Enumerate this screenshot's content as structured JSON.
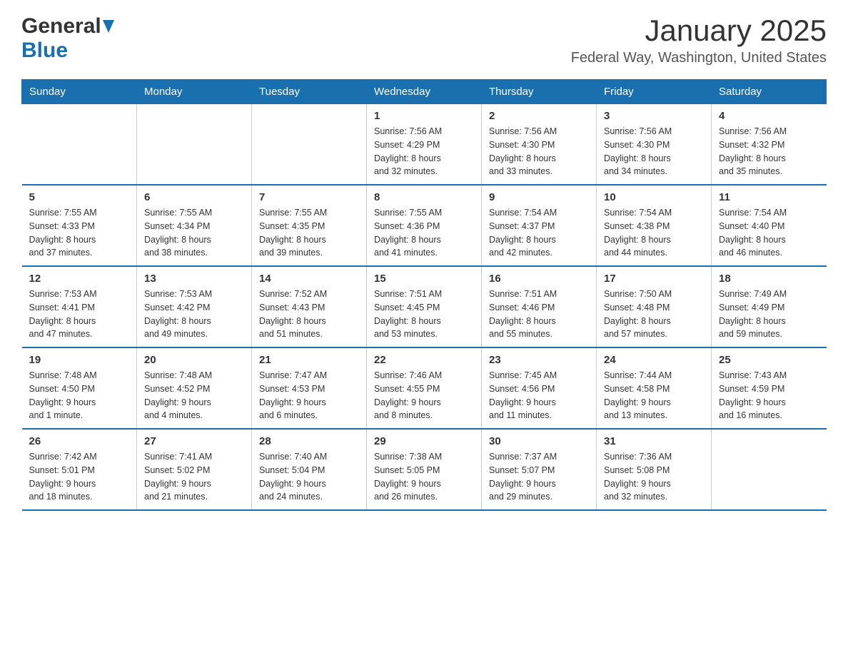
{
  "header": {
    "logo_general": "General",
    "logo_blue": "Blue",
    "month_title": "January 2025",
    "location": "Federal Way, Washington, United States"
  },
  "calendar": {
    "days_of_week": [
      "Sunday",
      "Monday",
      "Tuesday",
      "Wednesday",
      "Thursday",
      "Friday",
      "Saturday"
    ],
    "weeks": [
      [
        {
          "day": "",
          "info": ""
        },
        {
          "day": "",
          "info": ""
        },
        {
          "day": "",
          "info": ""
        },
        {
          "day": "1",
          "info": "Sunrise: 7:56 AM\nSunset: 4:29 PM\nDaylight: 8 hours\nand 32 minutes."
        },
        {
          "day": "2",
          "info": "Sunrise: 7:56 AM\nSunset: 4:30 PM\nDaylight: 8 hours\nand 33 minutes."
        },
        {
          "day": "3",
          "info": "Sunrise: 7:56 AM\nSunset: 4:30 PM\nDaylight: 8 hours\nand 34 minutes."
        },
        {
          "day": "4",
          "info": "Sunrise: 7:56 AM\nSunset: 4:32 PM\nDaylight: 8 hours\nand 35 minutes."
        }
      ],
      [
        {
          "day": "5",
          "info": "Sunrise: 7:55 AM\nSunset: 4:33 PM\nDaylight: 8 hours\nand 37 minutes."
        },
        {
          "day": "6",
          "info": "Sunrise: 7:55 AM\nSunset: 4:34 PM\nDaylight: 8 hours\nand 38 minutes."
        },
        {
          "day": "7",
          "info": "Sunrise: 7:55 AM\nSunset: 4:35 PM\nDaylight: 8 hours\nand 39 minutes."
        },
        {
          "day": "8",
          "info": "Sunrise: 7:55 AM\nSunset: 4:36 PM\nDaylight: 8 hours\nand 41 minutes."
        },
        {
          "day": "9",
          "info": "Sunrise: 7:54 AM\nSunset: 4:37 PM\nDaylight: 8 hours\nand 42 minutes."
        },
        {
          "day": "10",
          "info": "Sunrise: 7:54 AM\nSunset: 4:38 PM\nDaylight: 8 hours\nand 44 minutes."
        },
        {
          "day": "11",
          "info": "Sunrise: 7:54 AM\nSunset: 4:40 PM\nDaylight: 8 hours\nand 46 minutes."
        }
      ],
      [
        {
          "day": "12",
          "info": "Sunrise: 7:53 AM\nSunset: 4:41 PM\nDaylight: 8 hours\nand 47 minutes."
        },
        {
          "day": "13",
          "info": "Sunrise: 7:53 AM\nSunset: 4:42 PM\nDaylight: 8 hours\nand 49 minutes."
        },
        {
          "day": "14",
          "info": "Sunrise: 7:52 AM\nSunset: 4:43 PM\nDaylight: 8 hours\nand 51 minutes."
        },
        {
          "day": "15",
          "info": "Sunrise: 7:51 AM\nSunset: 4:45 PM\nDaylight: 8 hours\nand 53 minutes."
        },
        {
          "day": "16",
          "info": "Sunrise: 7:51 AM\nSunset: 4:46 PM\nDaylight: 8 hours\nand 55 minutes."
        },
        {
          "day": "17",
          "info": "Sunrise: 7:50 AM\nSunset: 4:48 PM\nDaylight: 8 hours\nand 57 minutes."
        },
        {
          "day": "18",
          "info": "Sunrise: 7:49 AM\nSunset: 4:49 PM\nDaylight: 8 hours\nand 59 minutes."
        }
      ],
      [
        {
          "day": "19",
          "info": "Sunrise: 7:48 AM\nSunset: 4:50 PM\nDaylight: 9 hours\nand 1 minute."
        },
        {
          "day": "20",
          "info": "Sunrise: 7:48 AM\nSunset: 4:52 PM\nDaylight: 9 hours\nand 4 minutes."
        },
        {
          "day": "21",
          "info": "Sunrise: 7:47 AM\nSunset: 4:53 PM\nDaylight: 9 hours\nand 6 minutes."
        },
        {
          "day": "22",
          "info": "Sunrise: 7:46 AM\nSunset: 4:55 PM\nDaylight: 9 hours\nand 8 minutes."
        },
        {
          "day": "23",
          "info": "Sunrise: 7:45 AM\nSunset: 4:56 PM\nDaylight: 9 hours\nand 11 minutes."
        },
        {
          "day": "24",
          "info": "Sunrise: 7:44 AM\nSunset: 4:58 PM\nDaylight: 9 hours\nand 13 minutes."
        },
        {
          "day": "25",
          "info": "Sunrise: 7:43 AM\nSunset: 4:59 PM\nDaylight: 9 hours\nand 16 minutes."
        }
      ],
      [
        {
          "day": "26",
          "info": "Sunrise: 7:42 AM\nSunset: 5:01 PM\nDaylight: 9 hours\nand 18 minutes."
        },
        {
          "day": "27",
          "info": "Sunrise: 7:41 AM\nSunset: 5:02 PM\nDaylight: 9 hours\nand 21 minutes."
        },
        {
          "day": "28",
          "info": "Sunrise: 7:40 AM\nSunset: 5:04 PM\nDaylight: 9 hours\nand 24 minutes."
        },
        {
          "day": "29",
          "info": "Sunrise: 7:38 AM\nSunset: 5:05 PM\nDaylight: 9 hours\nand 26 minutes."
        },
        {
          "day": "30",
          "info": "Sunrise: 7:37 AM\nSunset: 5:07 PM\nDaylight: 9 hours\nand 29 minutes."
        },
        {
          "day": "31",
          "info": "Sunrise: 7:36 AM\nSunset: 5:08 PM\nDaylight: 9 hours\nand 32 minutes."
        },
        {
          "day": "",
          "info": ""
        }
      ]
    ]
  }
}
